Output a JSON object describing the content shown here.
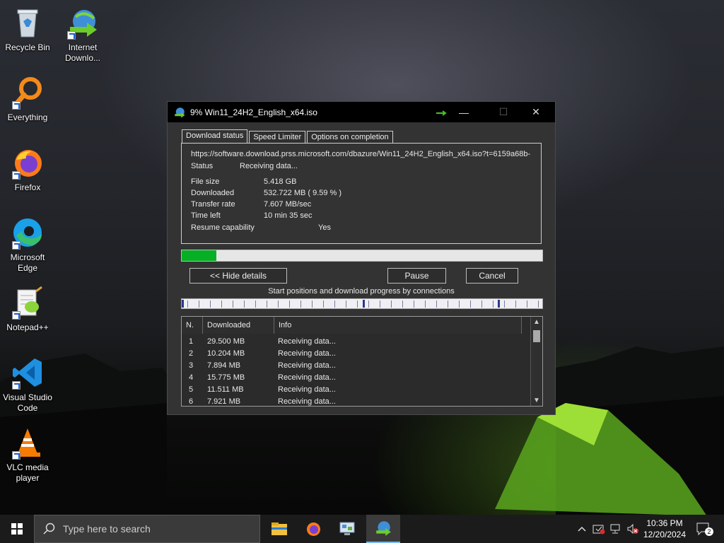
{
  "desktop": {
    "icons": [
      {
        "id": "recycle-bin",
        "label": "Recycle Bin"
      },
      {
        "id": "idm",
        "label": "Internet Downlo..."
      },
      {
        "id": "everything",
        "label": "Everything"
      },
      {
        "id": "firefox",
        "label": "Firefox"
      },
      {
        "id": "edge",
        "label": "Microsoft Edge"
      },
      {
        "id": "notepadpp",
        "label": "Notepad++"
      },
      {
        "id": "vscode",
        "label": "Visual Studio Code"
      },
      {
        "id": "vlc",
        "label": "VLC media player"
      }
    ]
  },
  "dialog": {
    "title": "9% Win11_24H2_English_x64.iso",
    "window_controls": {
      "minimize": "—",
      "maximize": "☐",
      "close": "✕"
    },
    "tabs": [
      "Download status",
      "Speed Limiter",
      "Options on completion"
    ],
    "active_tab": 0,
    "url": "https://software.download.prss.microsoft.com/dbazure/Win11_24H2_English_x64.iso?t=6159a68b-",
    "status_label": "Status",
    "status_value": "Receiving data...",
    "file_size_label": "File size",
    "file_size_value": "5.418  GB",
    "downloaded_label": "Downloaded",
    "downloaded_value": "532.722  MB  ( 9.59 % )",
    "transfer_rate_label": "Transfer rate",
    "transfer_rate_value": "7.607  MB/sec",
    "time_left_label": "Time left",
    "time_left_value": "10 min 35 sec",
    "resume_label": "Resume capability",
    "resume_value": "Yes",
    "progress_fraction": 0.0959,
    "hide_details_label": "<< Hide details",
    "pause_label": "Pause",
    "cancel_label": "Cancel",
    "connections_caption": "Start positions and download progress by connections",
    "table": {
      "headers": [
        "N.",
        "Downloaded",
        "Info"
      ],
      "rows": [
        [
          "1",
          "29.500  MB",
          "Receiving data..."
        ],
        [
          "2",
          "10.204  MB",
          "Receiving data..."
        ],
        [
          "3",
          "7.894  MB",
          "Receiving data..."
        ],
        [
          "4",
          "15.775  MB",
          "Receiving data..."
        ],
        [
          "5",
          "11.511  MB",
          "Receiving data..."
        ],
        [
          "6",
          "7.921  MB",
          "Receiving data..."
        ]
      ]
    }
  },
  "taskbar": {
    "search_placeholder": "Type here to search",
    "apps": [
      "file-explorer",
      "firefox",
      "control-panel",
      "internet-download-manager"
    ],
    "tray_icons": [
      "chevron-up-icon",
      "security-icon",
      "network-icon",
      "volume-muted-icon"
    ],
    "time": "10:36 PM",
    "date": "12/20/2024",
    "notification_count": "2"
  },
  "colors": {
    "progress": "#06b025",
    "dialog_bg": "#333333",
    "taskbar_bg": "#1b1b1b"
  }
}
